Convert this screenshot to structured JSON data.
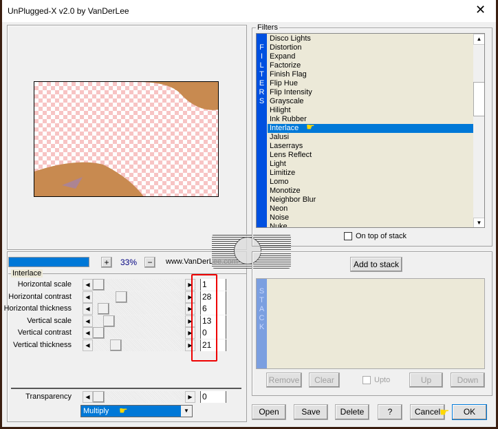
{
  "window": {
    "title": "UnPlugged-X v2.0 by VanDerLee",
    "close_icon": "close-icon"
  },
  "zoom": {
    "plus": "+",
    "value": "33%",
    "minus": "−",
    "website": "www.VanDerLee.com",
    "progress_percent": 100
  },
  "watermark": "claudiak",
  "interlace": {
    "group_label": "Interlace",
    "sliders": [
      {
        "label": "Horizontal scale",
        "value": "1",
        "fraction": 0.0
      },
      {
        "label": "Horizontal contrast",
        "value": "28",
        "fraction": 0.28
      },
      {
        "label": "Horizontal thickness",
        "value": "6",
        "fraction": 0.06
      },
      {
        "label": "Vertical scale",
        "value": "13",
        "fraction": 0.13
      },
      {
        "label": "Vertical contrast",
        "value": "0",
        "fraction": 0.0
      },
      {
        "label": "Vertical thickness",
        "value": "21",
        "fraction": 0.21
      }
    ]
  },
  "transparency": {
    "label": "Transparency",
    "value": "0",
    "fraction": 0.0
  },
  "blend_mode": {
    "selected": "Multiply"
  },
  "filters": {
    "group_label": "Filters",
    "strip_text": [
      "F",
      "I",
      "L",
      "T",
      "E",
      "R",
      "S"
    ],
    "items": [
      "Disco Lights",
      "Distortion",
      "Expand",
      "Factorize",
      "Finish Flag",
      "Flip Hue",
      "Flip Intensity",
      "Grayscale",
      "Hilight",
      "Ink Rubber",
      "Interlace",
      "Jalusi",
      "Laserrays",
      "Lens Reflect",
      "Light",
      "Limitize",
      "Lomo",
      "Monotize",
      "Neighbor Blur",
      "Neon",
      "Noise",
      "Nuke"
    ],
    "selected": "Interlace",
    "on_top_label": "On top of stack"
  },
  "stack": {
    "add_label": "Add to stack",
    "strip_text": [
      "S",
      "T",
      "A",
      "C",
      "K"
    ],
    "remove": "Remove",
    "clear": "Clear",
    "upto": "Upto",
    "up": "Up",
    "down": "Down"
  },
  "footer": {
    "open": "Open",
    "save": "Save",
    "delete": "Delete",
    "help": "?",
    "cancel": "Cancel",
    "ok": "OK"
  },
  "colors": {
    "accent": "#0078d7",
    "strip": "#0050e0",
    "stack_strip": "#7b9fe0",
    "highlight": "#ff0000"
  }
}
